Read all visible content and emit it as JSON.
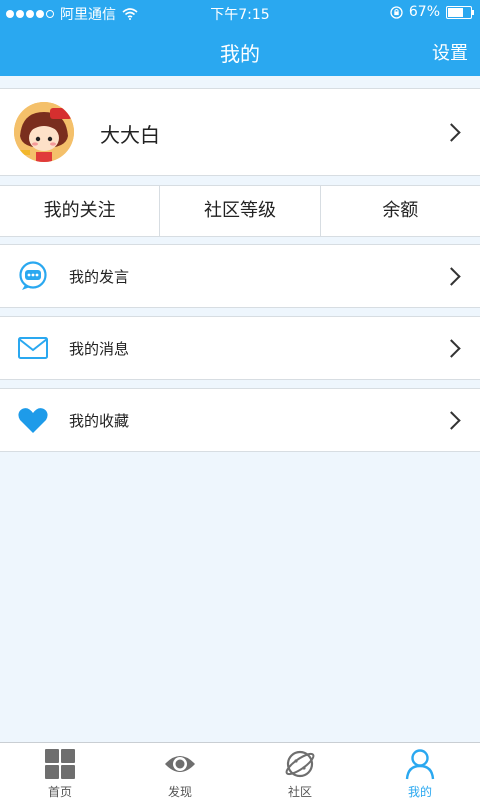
{
  "status": {
    "carrier": "阿里通信",
    "time": "下午7:15",
    "battery": "67%",
    "battery_level": 0.67
  },
  "nav": {
    "title": "我的",
    "action": "设置"
  },
  "profile": {
    "name": "大大白"
  },
  "tabs": [
    "我的关注",
    "社区等级",
    "余额"
  ],
  "rows": [
    {
      "label": "我的发言",
      "icon": "chat-bubble-icon"
    },
    {
      "label": "我的消息",
      "icon": "envelope-icon"
    },
    {
      "label": "我的收藏",
      "icon": "heart-icon"
    }
  ],
  "tabbar": [
    {
      "label": "首页",
      "icon": "grid-icon"
    },
    {
      "label": "发现",
      "icon": "eye-icon"
    },
    {
      "label": "社区",
      "icon": "planet-icon"
    },
    {
      "label": "我的",
      "icon": "user-icon",
      "active": true
    }
  ],
  "colors": {
    "accent": "#2aa8f0",
    "background": "#eef6fd"
  }
}
